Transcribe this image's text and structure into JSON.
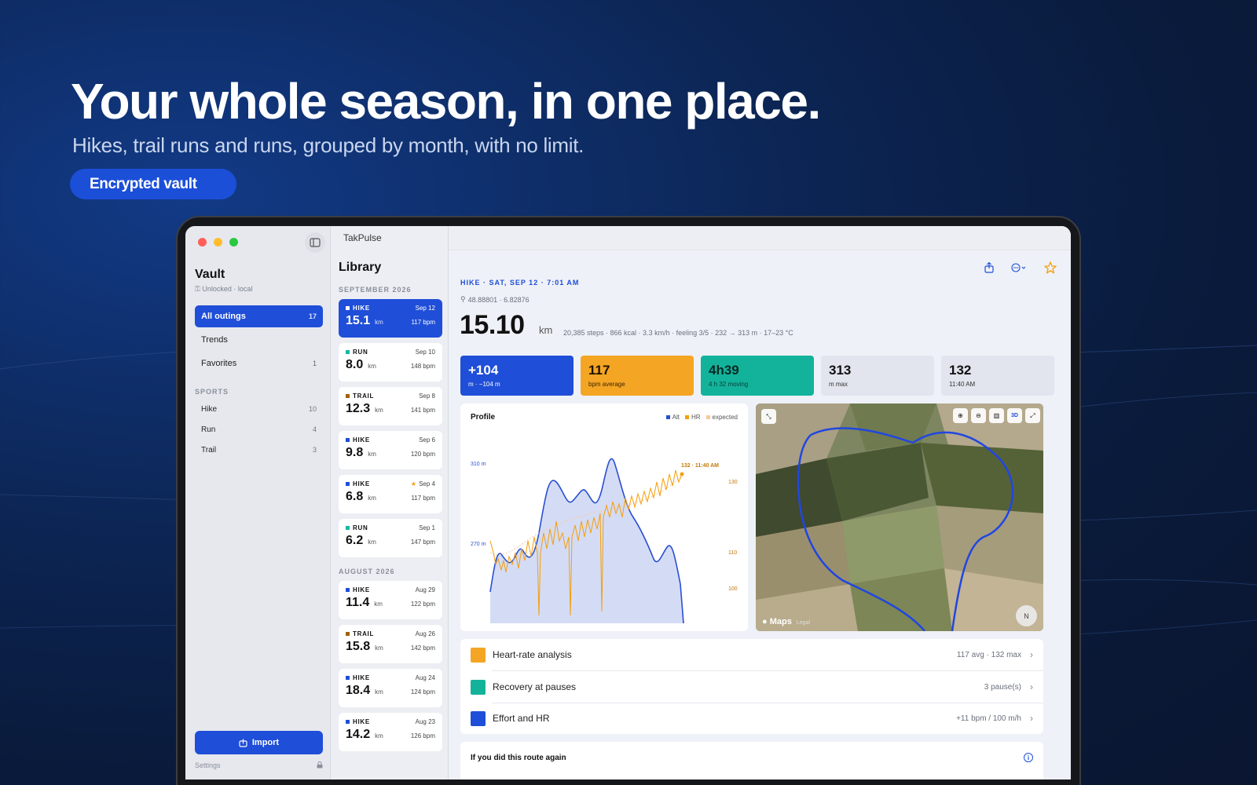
{
  "hero": {
    "title": "Your whole season, in one place.",
    "subtitle": "Hikes, trail runs and runs, grouped by month, with no limit.",
    "pill": "Encrypted vault"
  },
  "colors": {
    "accent": "#1f4ed8",
    "hike": "#1f4ed8",
    "run": "#14b8a6",
    "trail": "#a16207",
    "hr": "#f59e0b",
    "recovery": "#14b8a6"
  },
  "sidebar": {
    "vault_title": "Vault",
    "vault_status": "Unlocked · local",
    "items": [
      {
        "label": "All outings",
        "count": "17"
      },
      {
        "label": "Trends",
        "count": ""
      },
      {
        "label": "Favorites",
        "count": "1"
      }
    ],
    "sports_label": "SPORTS",
    "sports": [
      {
        "label": "Hike",
        "count": "10"
      },
      {
        "label": "Run",
        "count": "4"
      },
      {
        "label": "Trail",
        "count": "3"
      }
    ],
    "import_label": "Import",
    "settings_label": "Settings"
  },
  "library": {
    "app_name": "TakPulse",
    "title": "Library",
    "months": [
      {
        "label": "SEPTEMBER 2026",
        "outings": [
          {
            "sport": "HIKE",
            "date": "Sep 12",
            "km": "15.1",
            "unit": "km",
            "bpm": "117 bpm",
            "favorite": false
          },
          {
            "sport": "RUN",
            "date": "Sep 10",
            "km": "8.0",
            "unit": "km",
            "bpm": "148 bpm",
            "favorite": false
          },
          {
            "sport": "TRAIL",
            "date": "Sep 8",
            "km": "12.3",
            "unit": "km",
            "bpm": "141 bpm",
            "favorite": false
          },
          {
            "sport": "HIKE",
            "date": "Sep 6",
            "km": "9.8",
            "unit": "km",
            "bpm": "120 bpm",
            "favorite": false
          },
          {
            "sport": "HIKE",
            "date": "Sep 4",
            "km": "6.8",
            "unit": "km",
            "bpm": "117 bpm",
            "favorite": true
          },
          {
            "sport": "RUN",
            "date": "Sep 1",
            "km": "6.2",
            "unit": "km",
            "bpm": "147 bpm",
            "favorite": false
          }
        ]
      },
      {
        "label": "AUGUST 2026",
        "outings": [
          {
            "sport": "HIKE",
            "date": "Aug 29",
            "km": "11.4",
            "unit": "km",
            "bpm": "122 bpm",
            "favorite": false
          },
          {
            "sport": "TRAIL",
            "date": "Aug 26",
            "km": "15.8",
            "unit": "km",
            "bpm": "142 bpm",
            "favorite": false
          },
          {
            "sport": "HIKE",
            "date": "Aug 24",
            "km": "18.4",
            "unit": "km",
            "bpm": "124 bpm",
            "favorite": false
          },
          {
            "sport": "HIKE",
            "date": "Aug 23",
            "km": "14.2",
            "unit": "km",
            "bpm": "126 bpm",
            "favorite": false
          }
        ]
      }
    ]
  },
  "detail": {
    "header": "HIKE · SAT, SEP 12 · 7:01 AM",
    "coords": "48.88801 · 6.82876",
    "distance": "15.10",
    "distance_unit": "km",
    "meta": "20,385 steps · 866 kcal · 3.3 km/h · feeling 3/5 · 232 → 313 m · 17–23 °C",
    "stats": [
      {
        "value": "+104",
        "label": "m · −104 m",
        "bg": "#1f4ed8",
        "fg": "#ffffff",
        "lfg": "#ffffff"
      },
      {
        "value": "117",
        "label": "bpm average",
        "bg": "#f5a524",
        "fg": "#1a1200",
        "lfg": "#3a2600"
      },
      {
        "value": "4h39",
        "label": "4 h 32 moving",
        "bg": "#13b39b",
        "fg": "#042a24",
        "lfg": "#0b3d35"
      },
      {
        "value": "313",
        "label": "m max",
        "bg": "#e2e5ee",
        "fg": "#111111",
        "lfg": "#333333"
      },
      {
        "value": "132",
        "label": "11:40 AM",
        "bg": "#e2e5ee",
        "fg": "#111111",
        "lfg": "#333333"
      }
    ],
    "profile": {
      "title": "Profile",
      "legend": [
        "Alt",
        "HR",
        "expected"
      ],
      "alt_ticks": [
        "310 m",
        "270 m"
      ],
      "hr_ticks": [
        "130",
        "110",
        "100"
      ],
      "peak_label": "132 · 11:40 AM"
    },
    "map": {
      "brand": "Maps",
      "legal": "Legal",
      "compass": "N",
      "mode_3d": "3D"
    },
    "rows": [
      {
        "title": "Heart-rate analysis",
        "value": "117 avg · 132 max",
        "color": "#f5a524"
      },
      {
        "title": "Recovery at pauses",
        "value": "3 pause(s)",
        "color": "#13b39b"
      },
      {
        "title": "Effort and HR",
        "value": "+11 bpm / 100 m/h",
        "color": "#1f4ed8"
      }
    ],
    "again_title": "If you did this route again",
    "info_glyph": "i"
  }
}
